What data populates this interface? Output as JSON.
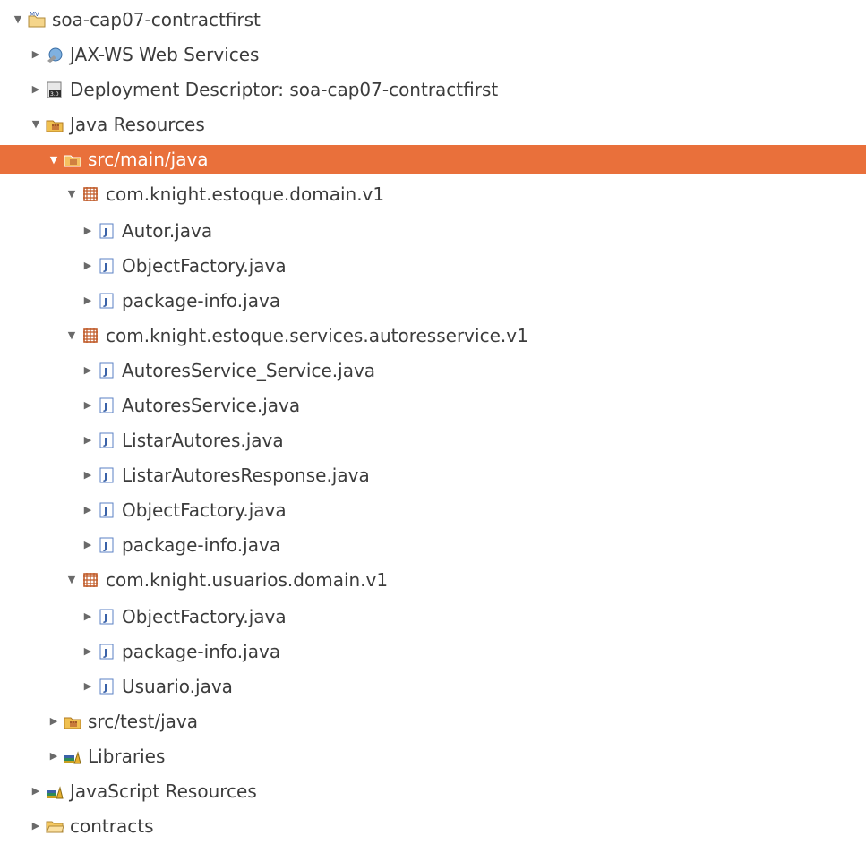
{
  "tree": {
    "rows": [
      {
        "label": "soa-cap07-contractfirst",
        "icon": "project-icon",
        "twisty": "▼"
      },
      {
        "label": "JAX-WS Web Services",
        "icon": "jaxws-icon",
        "twisty": "▶"
      },
      {
        "label": "Deployment Descriptor: soa-cap07-contractfirst",
        "icon": "deployment-descriptor-icon",
        "twisty": "▶"
      },
      {
        "label": "Java Resources",
        "icon": "java-resources-icon",
        "twisty": "▼"
      },
      {
        "label": "src/main/java",
        "icon": "source-folder-icon",
        "twisty": "▼",
        "selected": true
      },
      {
        "label": "com.knight.estoque.domain.v1",
        "icon": "package-icon",
        "twisty": "▼"
      },
      {
        "label": "Autor.java",
        "icon": "java-file-icon",
        "twisty": "▶"
      },
      {
        "label": "ObjectFactory.java",
        "icon": "java-file-icon",
        "twisty": "▶"
      },
      {
        "label": "package-info.java",
        "icon": "java-file-icon",
        "twisty": "▶"
      },
      {
        "label": "com.knight.estoque.services.autoresservice.v1",
        "icon": "package-icon",
        "twisty": "▼"
      },
      {
        "label": "AutoresService_Service.java",
        "icon": "java-file-icon",
        "twisty": "▶"
      },
      {
        "label": "AutoresService.java",
        "icon": "java-file-icon",
        "twisty": "▶"
      },
      {
        "label": "ListarAutores.java",
        "icon": "java-file-icon",
        "twisty": "▶"
      },
      {
        "label": "ListarAutoresResponse.java",
        "icon": "java-file-icon",
        "twisty": "▶"
      },
      {
        "label": "ObjectFactory.java",
        "icon": "java-file-icon",
        "twisty": "▶"
      },
      {
        "label": "package-info.java",
        "icon": "java-file-icon",
        "twisty": "▶"
      },
      {
        "label": "com.knight.usuarios.domain.v1",
        "icon": "package-icon",
        "twisty": "▼"
      },
      {
        "label": "ObjectFactory.java",
        "icon": "java-file-icon",
        "twisty": "▶"
      },
      {
        "label": "package-info.java",
        "icon": "java-file-icon",
        "twisty": "▶"
      },
      {
        "label": "Usuario.java",
        "icon": "java-file-icon",
        "twisty": "▶"
      },
      {
        "label": "src/test/java",
        "icon": "source-folder-icon",
        "twisty": "▶"
      },
      {
        "label": "Libraries",
        "icon": "libraries-icon",
        "twisty": "▶"
      },
      {
        "label": "JavaScript Resources",
        "icon": "libraries-icon",
        "twisty": "▶"
      },
      {
        "label": "contracts",
        "icon": "folder-icon",
        "twisty": "▶"
      }
    ]
  },
  "colors": {
    "selection": "#e9703b",
    "text": "#3c3c3c",
    "background": "#ffffff"
  }
}
